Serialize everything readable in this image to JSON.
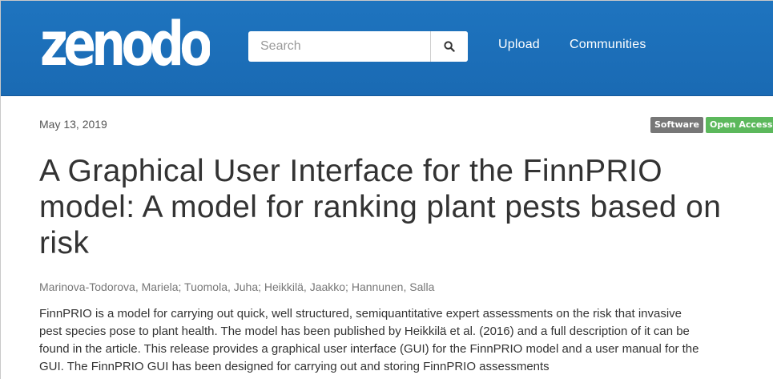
{
  "header": {
    "logo_text": "zenodo",
    "search": {
      "placeholder": "Search",
      "value": ""
    },
    "search_button_icon": "search-icon",
    "nav": {
      "upload": "Upload",
      "communities": "Communities"
    }
  },
  "record": {
    "date": "May 13, 2019",
    "badges": {
      "type": "Software",
      "access": "Open Access"
    },
    "title": "A Graphical User Interface for the FinnPRIO model: A model for ranking plant pests based on risk",
    "authors": "Marinova-Todorova, Mariela; Tuomola, Juha; Heikkilä, Jaakko; Hannunen, Salla",
    "abstract_lines": [
      "FinnPRIO is a model for carrying out quick, well structured, semiquantitative expert assessments on the risk that invasive",
      "pest species pose to plant health. The model has been published by Heikkilä et al. (2016) and a full description of it can be",
      "found in the article. This release provides a graphical user interface (GUI) for the FinnPRIO model and a user manual for the",
      "GUI. The FinnPRIO GUI has been designed for carrying out and storing FinnPRIO assessments"
    ]
  },
  "colors": {
    "header_bg": "#1e74bf",
    "badge_software": "#777777",
    "badge_open_access": "#5cb85c"
  }
}
